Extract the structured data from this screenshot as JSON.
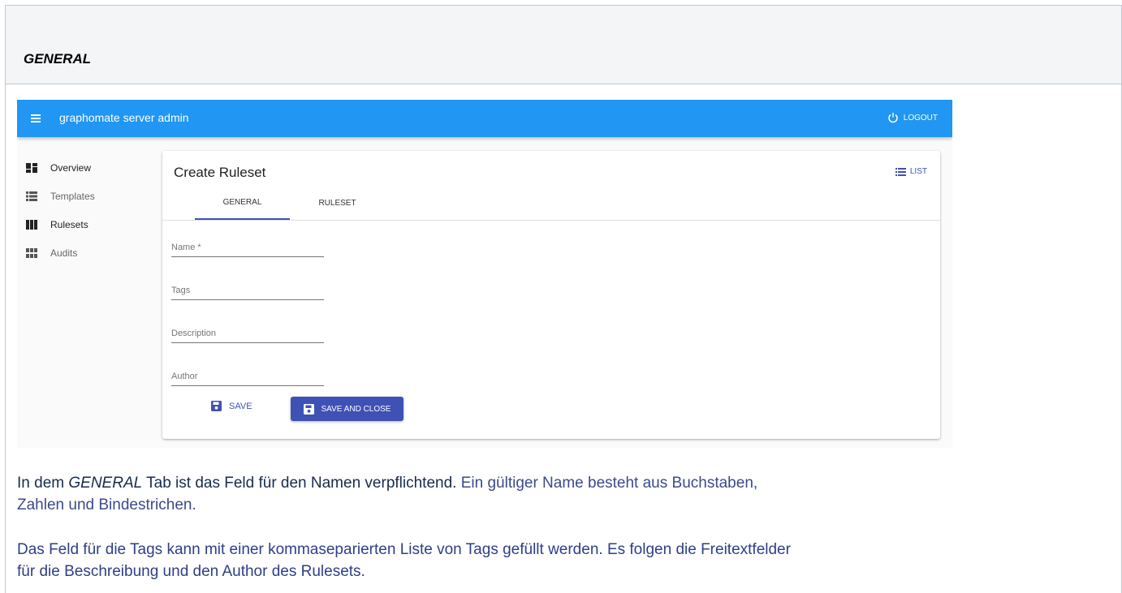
{
  "section": {
    "title": "GENERAL"
  },
  "app": {
    "title": "graphomate server admin",
    "logout_label": "LOGOUT",
    "colors": {
      "appbar": "#2196f3",
      "primary": "#3f51b5"
    }
  },
  "sidebar": {
    "items": [
      {
        "label": "Overview",
        "icon": "dashboard-icon"
      },
      {
        "label": "Templates",
        "icon": "view-list-icon"
      },
      {
        "label": "Rulesets",
        "icon": "view-column-icon"
      },
      {
        "label": "Audits",
        "icon": "view-module-icon"
      }
    ]
  },
  "card": {
    "title": "Create Ruleset",
    "list_label": "LIST",
    "tabs": [
      {
        "label": "GENERAL"
      },
      {
        "label": "RULESET"
      }
    ],
    "fields": {
      "name": {
        "placeholder": "Name *",
        "value": ""
      },
      "tags": {
        "placeholder": "Tags",
        "value": ""
      },
      "description": {
        "placeholder": "Description",
        "value": ""
      },
      "author": {
        "placeholder": "Author",
        "value": ""
      }
    },
    "save_label": "SAVE",
    "save_close_label": "SAVE AND CLOSE"
  },
  "text": {
    "p1_prefix": "In dem ",
    "p1_em": "GENERAL",
    "p1_mid": " Tab ist das Feld für den Namen verpflichtend. ",
    "p1_link": "Ein gültiger Name besteht aus Buchstaben,",
    "p1_line2": "Zahlen und Bindestrichen.",
    "p2_line1": "Das Feld für die Tags kann mit einer kommaseparierten Liste von Tags gefüllt werden. Es folgen die Freitextfelder",
    "p2_line2": "für die Beschreibung und den Author des Rulesets."
  }
}
